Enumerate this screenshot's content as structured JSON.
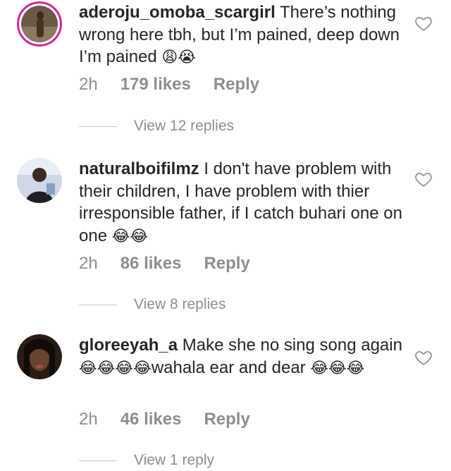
{
  "comments": [
    {
      "username": "aderoju_omoba_scargirl",
      "text": "There’s nothing wrong here tbh, but I’m pained, deep down I’m pained",
      "emoji": "😩😭",
      "time": "2h",
      "likes": "179 likes",
      "reply": "Reply",
      "view_replies": "View 12 replies",
      "icon": "heart-outline-icon"
    },
    {
      "username": "naturalboifilmz",
      "text": "I don't have problem with their children, I have problem with thier irresponsible father, if I catch buhari one on one",
      "emoji": "😂😂",
      "time": "2h",
      "likes": "86 likes",
      "reply": "Reply",
      "view_replies": "View 8 replies",
      "icon": "heart-outline-icon"
    },
    {
      "username": "gloreeyah_a",
      "text": "Make she no sing song again",
      "emoji_mid": "😂😂😂😂",
      "text_after": "wahala ear and dear",
      "emoji": "😂😂😂",
      "time": "2h",
      "likes": "46 likes",
      "reply": "Reply",
      "view_replies": "View 1 reply",
      "icon": "heart-outline-icon"
    }
  ],
  "colors": {
    "text": "#262626",
    "muted": "#8e8e8e",
    "story_ring": "#d6249f"
  }
}
